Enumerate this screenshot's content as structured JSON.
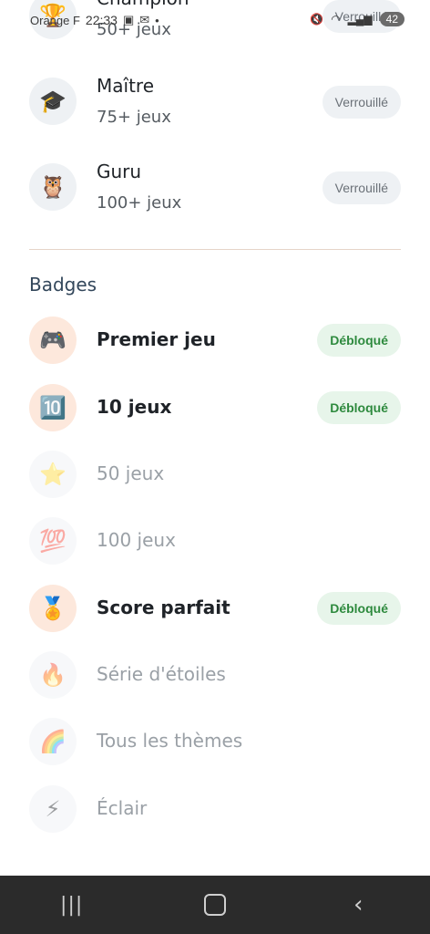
{
  "status": {
    "carrier": "Orange F",
    "time": "22:33",
    "battery": "42"
  },
  "levels": [
    {
      "icon": "🏆",
      "title": "Champion",
      "sub": "50+ jeux",
      "status": "Verrouillé"
    },
    {
      "icon": "🎓",
      "title": "Maître",
      "sub": "75+ jeux",
      "status": "Verrouillé"
    },
    {
      "icon": "🦉",
      "title": "Guru",
      "sub": "100+ jeux",
      "status": "Verrouillé"
    }
  ],
  "badges_section": {
    "title": "Badges",
    "items": [
      {
        "icon": "🎮",
        "label": "Premier jeu",
        "status": "Débloqué"
      },
      {
        "icon": "🔟",
        "label": "10 jeux",
        "status": "Débloqué"
      },
      {
        "icon": "⭐",
        "label": "50 jeux"
      },
      {
        "icon": "💯",
        "label": "100 jeux"
      },
      {
        "icon": "🏅",
        "label": "Score parfait",
        "status": "Débloqué"
      },
      {
        "icon": "🔥",
        "label": "Série d'étoiles"
      },
      {
        "icon": "🌈",
        "label": "Tous les thèmes"
      },
      {
        "icon": "⚡",
        "label": "Éclair"
      }
    ]
  },
  "nav": {
    "recent": "|||",
    "back": "‹"
  }
}
